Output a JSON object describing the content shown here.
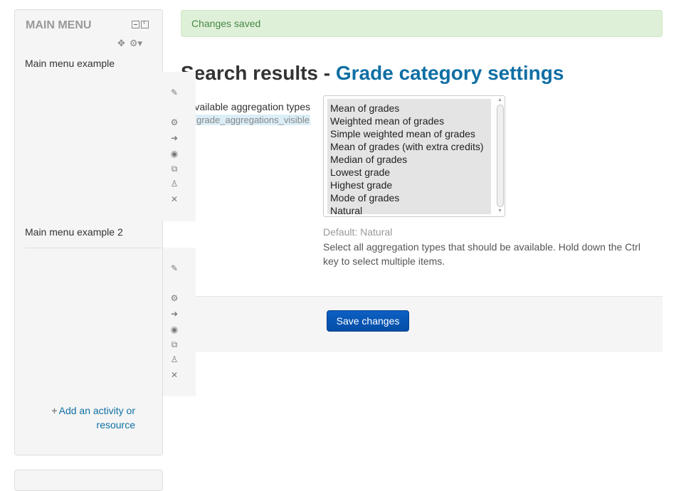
{
  "notification": "Changes saved",
  "heading": {
    "prefix": "Search results - ",
    "link": "Grade category settings"
  },
  "setting": {
    "label": "Available aggregation types",
    "name": "grade_aggregations_visible",
    "options": [
      "Mean of grades",
      "Weighted mean of grades",
      "Simple weighted mean of grades",
      "Mean of grades (with extra credits)",
      "Median of grades",
      "Lowest grade",
      "Highest grade",
      "Mode of grades",
      "Natural"
    ],
    "default": "Default: Natural",
    "description": "Select all aggregation types that should be available. Hold down the Ctrl key to select multiple items."
  },
  "save_button": "Save changes",
  "block": {
    "title": "MAIN MENU",
    "items": [
      {
        "title": "Main menu example"
      },
      {
        "title": "Main menu example 2"
      }
    ],
    "add_activity": "Add an activity or resource"
  },
  "icons": {
    "edit_title": "pencil-tilted-icon",
    "settings": "gear-icon",
    "move_right": "arrow-right-icon",
    "show_hide": "eye-icon",
    "duplicate": "duplicate-icon",
    "assign_roles": "user-plus-icon",
    "delete": "close-icon"
  }
}
